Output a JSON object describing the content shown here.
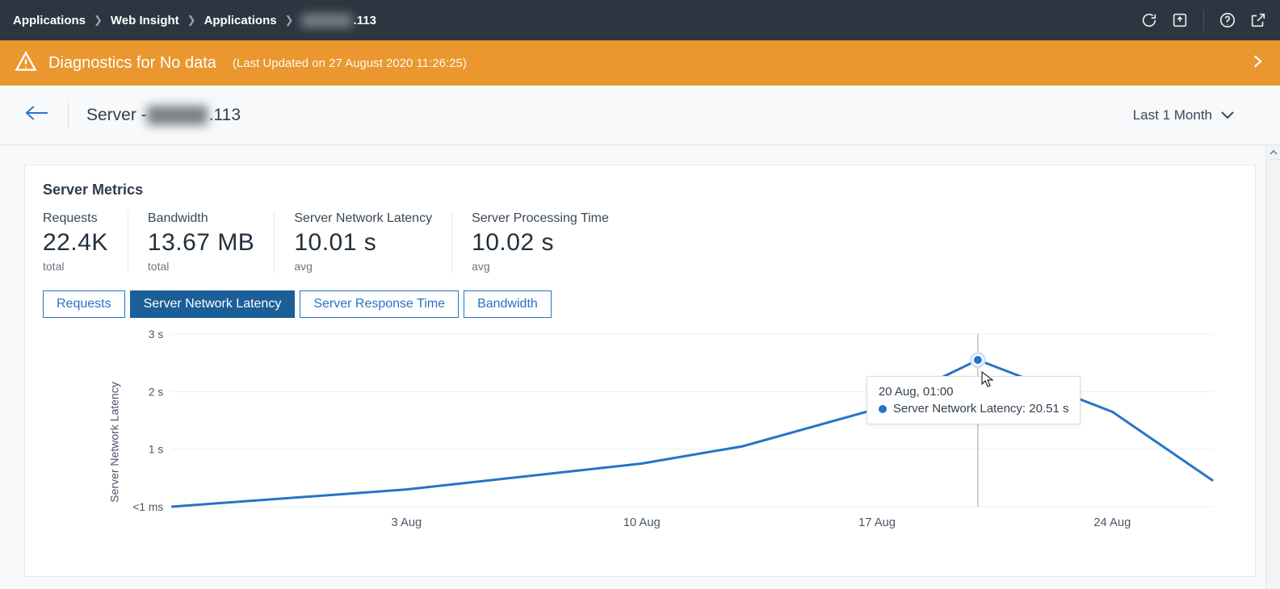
{
  "breadcrumb": {
    "items": [
      "Applications",
      "Web Insight",
      "Applications"
    ],
    "last_suffix": ".113"
  },
  "diag": {
    "title": "Diagnostics for No data",
    "updated": "(Last Updated on 27 August 2020 11:26:25)"
  },
  "subheader": {
    "server_prefix": "Server - ",
    "server_suffix": ".113",
    "range": "Last 1 Month"
  },
  "card": {
    "title": "Server Metrics",
    "tiles": [
      {
        "label": "Requests",
        "value": "22.4K",
        "sub": "total"
      },
      {
        "label": "Bandwidth",
        "value": "13.67 MB",
        "sub": "total"
      },
      {
        "label": "Server Network Latency",
        "value": "10.01 s",
        "sub": "avg"
      },
      {
        "label": "Server Processing Time",
        "value": "10.02 s",
        "sub": "avg"
      }
    ],
    "tabs": [
      {
        "label": "Requests",
        "active": false
      },
      {
        "label": "Server Network Latency",
        "active": true
      },
      {
        "label": "Server Response Time",
        "active": false
      },
      {
        "label": "Bandwidth",
        "active": false
      }
    ]
  },
  "chart_data": {
    "type": "line",
    "title": "",
    "xlabel": "",
    "ylabel": "Server Network Latency",
    "y_ticks": [
      "<1 ms",
      "1 s",
      "2 s",
      "3 s"
    ],
    "x_ticks": [
      "3 Aug",
      "10 Aug",
      "17 Aug",
      "24 Aug"
    ],
    "series": [
      {
        "name": "Server Network Latency",
        "color": "#2673c9",
        "points": [
          {
            "x_label": "27 Jul",
            "y_plot": 0.0
          },
          {
            "x_label": "3 Aug",
            "y_plot": 0.3
          },
          {
            "x_label": "10 Aug",
            "y_plot": 0.75
          },
          {
            "x_label": "13 Aug",
            "y_plot": 1.05
          },
          {
            "x_label": "17 Aug",
            "y_plot": 1.7
          },
          {
            "x_label": "20 Aug",
            "y_plot": 2.55,
            "highlight": true
          },
          {
            "x_label": "24 Aug",
            "y_plot": 1.65
          },
          {
            "x_label": "27 Aug",
            "y_plot": 0.45
          }
        ]
      }
    ],
    "tooltip": {
      "time": "20 Aug, 01:00",
      "series": "Server Network Latency",
      "value": "20.51 s"
    }
  }
}
